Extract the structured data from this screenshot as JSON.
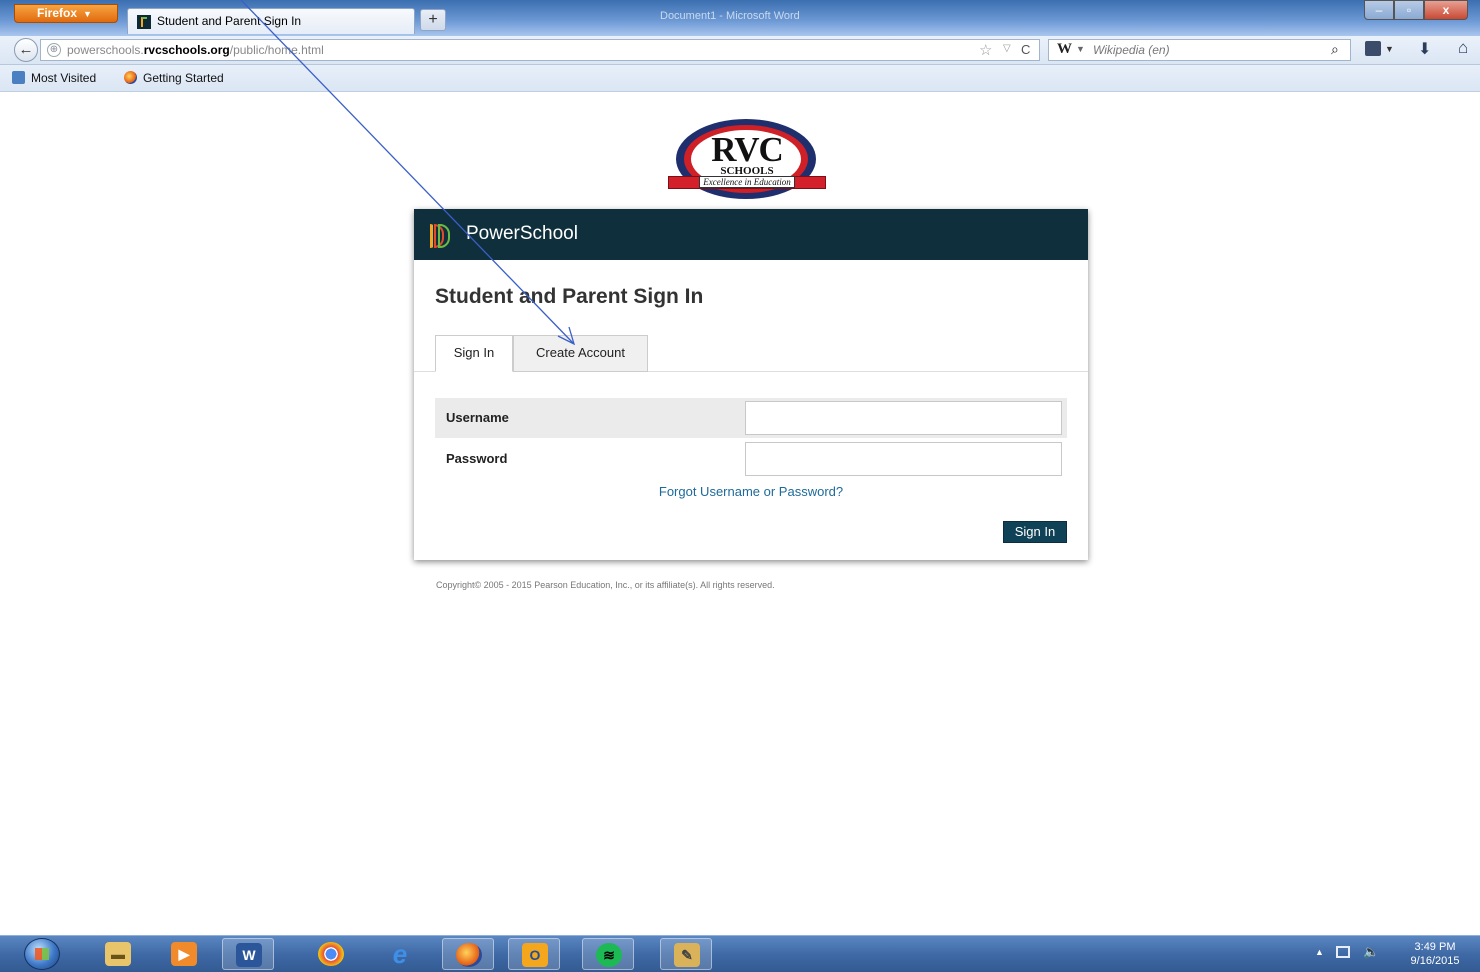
{
  "browser": {
    "menu_button": "Firefox",
    "tab_title": "Student and Parent Sign In",
    "new_tab_label": "+",
    "background_window_title": "Document1 - Microsoft Word",
    "url_gray_prefix": "powerschools.",
    "url_host": "rvcschools.org",
    "url_path": "/public/home.html",
    "search_engine_logo": "W",
    "search_placeholder": "Wikipedia (en)",
    "bookmarks": [
      "Most Visited",
      "Getting Started"
    ],
    "window_buttons": {
      "minimize": "–",
      "maximize": "▫",
      "close": "x"
    }
  },
  "logo": {
    "main": "RVC",
    "sub": "SCHOOLS",
    "motto": "Excellence in Education"
  },
  "card": {
    "brand": "PowerSchool",
    "heading": "Student and Parent Sign In",
    "tabs": [
      "Sign In",
      "Create Account"
    ],
    "username_label": "Username",
    "username_value": "",
    "password_label": "Password",
    "password_value": "",
    "forgot_link": "Forgot Username or Password?",
    "signin_button": "Sign In"
  },
  "copyright": "Copyright© 2005 - 2015 Pearson Education, Inc., or its affiliate(s). All rights reserved.",
  "taskbar": {
    "apps": [
      "windows-explorer",
      "media-player",
      "word",
      "chrome",
      "internet-explorer",
      "firefox",
      "outlook",
      "spotify",
      "notepad"
    ],
    "time": "3:49 PM",
    "date": "9/16/2015"
  },
  "colors": {
    "powerschool_header": "#0f2f3d",
    "link": "#1e6a9a",
    "signin_button": "#0f4257",
    "annotation_arrow": "#3a5fc8"
  }
}
